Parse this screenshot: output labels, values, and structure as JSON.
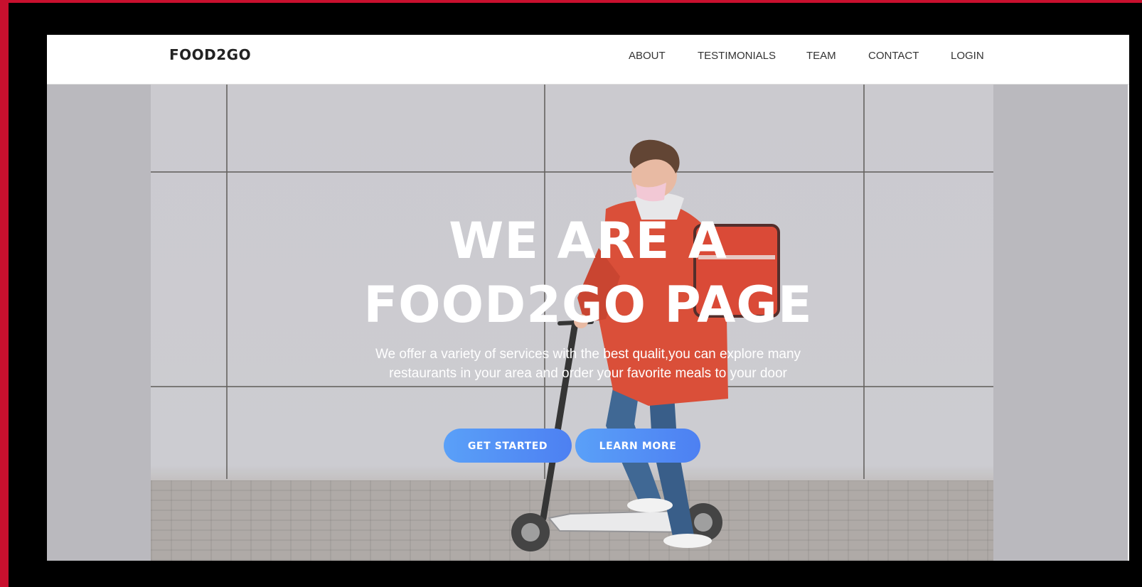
{
  "navbar": {
    "brand": "FOOD2GO",
    "links": [
      "ABOUT",
      "TESTIMONIALS",
      "TEAM",
      "CONTACT",
      "LOGIN"
    ]
  },
  "hero": {
    "title_line1": "WE ARE A",
    "title_line2": "FOOD2GO PAGE",
    "subtitle_line1": "We offer a variety of services with the best qualit,you can explore many",
    "subtitle_line2": "restaurants in your area and order your favorite meals to your door",
    "primary_button": "GET STARTED",
    "secondary_button": "LEARN MORE"
  },
  "colors": {
    "frame_border": "#c8102e",
    "button_gradient_start": "#5aa0f8",
    "button_gradient_end": "#4d80f2",
    "jacket": "#d8462f"
  }
}
